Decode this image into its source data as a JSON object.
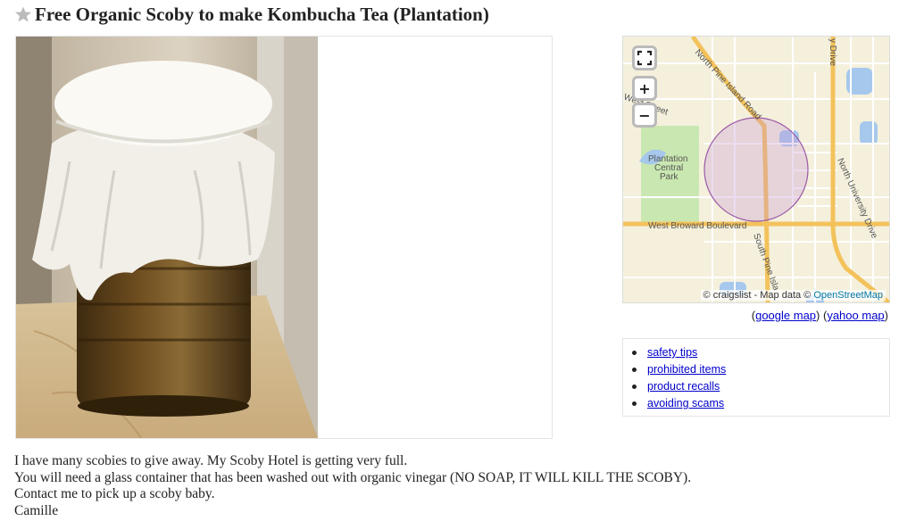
{
  "posting": {
    "title": "Free Organic Scoby to make Kombucha Tea (Plantation)",
    "body_lines": [
      "I have many scobies to give away. My Scoby Hotel is getting very full.",
      "You will need a glass container that has been washed out with organic vinegar (NO SOAP, IT WILL KILL THE SCOBY).",
      "Contact me to pick up a scoby baby.",
      "Camille"
    ]
  },
  "icons": {
    "favorite": "star-icon",
    "fullscreen": "fullscreen-icon",
    "zoom_in": "plus-icon",
    "zoom_out": "minus-icon"
  },
  "map": {
    "labels": {
      "north_pine_island": "North Pine Island Road",
      "west_street": "West Street",
      "park": [
        "Plantation",
        "Central",
        "Park"
      ],
      "west_broward": "West Broward Boulevard",
      "south_pine_island": "South Pine Isla",
      "north_university": "North University Drive",
      "drive_top": "y Drive"
    },
    "attribution_prefix": "© craigslist - Map data ©",
    "attribution_link": "OpenStreetMap",
    "colors": {
      "land": "#f4f0dc",
      "major_road": "#f3c25b",
      "minor_road": "#ffffff",
      "water": "#a6c8ec",
      "park": "#c9e7b0",
      "circle_stroke": "#9b59a6"
    }
  },
  "map_links": {
    "open_paren": "(",
    "google": "google map",
    "middle": ") (",
    "yahoo": "yahoo map",
    "close_paren": ")"
  },
  "safety_links": [
    "safety tips",
    "prohibited items",
    "product recalls",
    "avoiding scams"
  ],
  "colors": {
    "link": "#0000cc",
    "star": "#bbbbbb"
  }
}
